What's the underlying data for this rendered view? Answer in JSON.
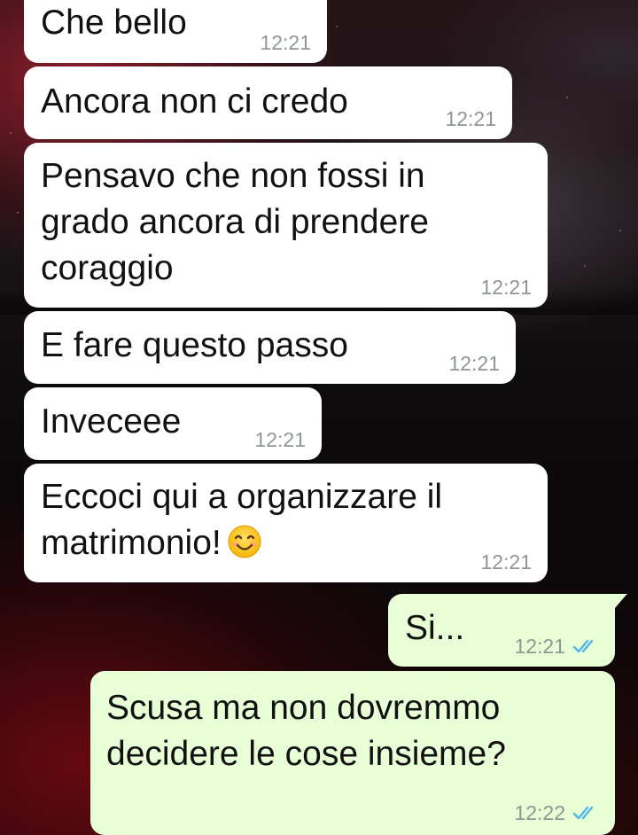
{
  "chat": {
    "messages": [
      {
        "direction": "incoming",
        "text": "Che bello",
        "time": "12:21"
      },
      {
        "direction": "incoming",
        "text": "Ancora non ci credo",
        "time": "12:21"
      },
      {
        "direction": "incoming",
        "text": "Pensavo che non fossi in\ngrado ancora di prendere\ncoraggio",
        "time": "12:21"
      },
      {
        "direction": "incoming",
        "text": "E fare questo passo",
        "time": "12:21"
      },
      {
        "direction": "incoming",
        "text": "Inveceee",
        "time": "12:21"
      },
      {
        "direction": "incoming",
        "text": "Eccoci qui a organizzare il\nmatrimonio!",
        "emoji": "smiling-face-emoji",
        "time": "12:21"
      },
      {
        "direction": "outgoing",
        "text": "Si...",
        "time": "12:21",
        "status": "read"
      },
      {
        "direction": "outgoing",
        "text": "Scusa ma non dovremmo\ndecidere le cose insieme?",
        "time": "12:22",
        "status": "read"
      }
    ]
  },
  "colors": {
    "incoming_bubble": "#ffffff",
    "outgoing_bubble": "#e8fed6",
    "timestamp": "#8f9791",
    "read_tick": "#4fb6ec"
  }
}
